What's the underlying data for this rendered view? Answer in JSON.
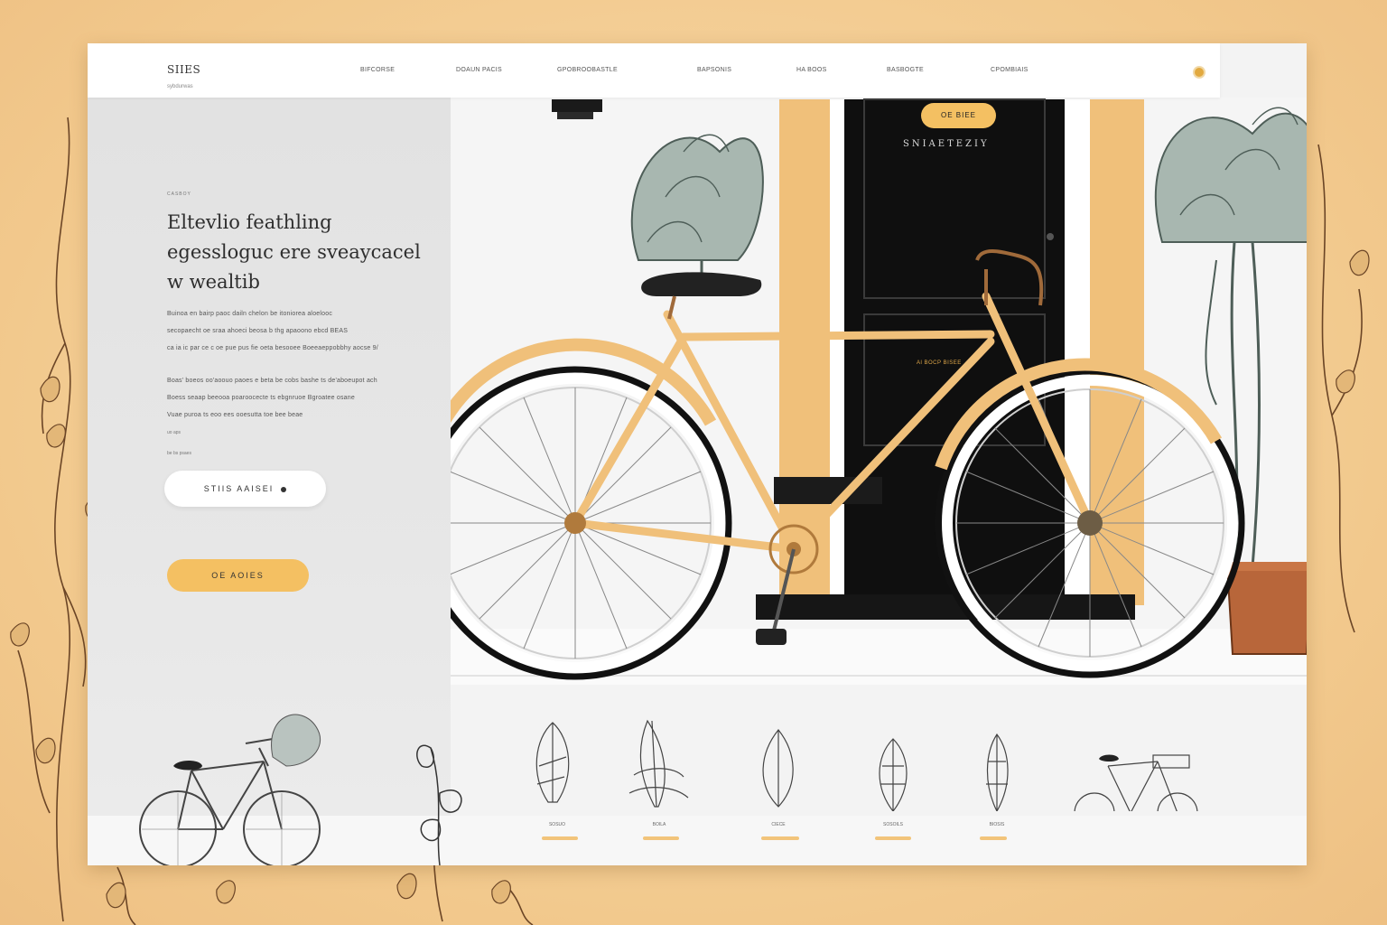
{
  "nav": {
    "logo": "SIIES",
    "tagline": "sybdurwas",
    "links": [
      "BIFCORSE",
      "DOAUN PACIS",
      "GPOBROOBASTLE",
      "BAPSONIS",
      "HA BOOS",
      "BASBOGTE",
      "CPOMBIAIS"
    ]
  },
  "hero": {
    "eyebrow": "CASBOY",
    "headline": [
      "Eltevlio feathling",
      "egessloguc ere sveaycacel",
      "w wealtib"
    ],
    "para1": [
      "Buinoa en bairp paoc dailn chelon be itoniorea aloelooc",
      "secopaecht oe sraa ahoeci beosa b thg apaoono ebcd BEAS",
      "ca ia ic par ce c oe pue pus fie oeta besooee Boeeaeppobbhy aocse 9/"
    ],
    "para2": [
      "Boas' boeos oo'aoouo paoes e beta be cobs bashe ts de'aboeupot ach",
      "Boess seaap beeooa poaroocecte ts ebgnruoe Bgroatee osane",
      "Vuae puroa ts eoo ees ooesutta toe bee beae"
    ],
    "small1": "uo aps",
    "small2": "be bs psaes",
    "button_primary": "STIIS AAISEI",
    "button_secondary": "OE AOIES"
  },
  "door": {
    "badge": "OE BIEE",
    "title": "SNIAETEZIY",
    "note": "Al BOCP BISEE"
  },
  "categories": [
    {
      "label": "SOSUO"
    },
    {
      "label": "BOILA"
    },
    {
      "label": "CIECE"
    },
    {
      "label": "SOSOILS"
    },
    {
      "label": "BIOSIS"
    }
  ],
  "colors": {
    "accent": "#f4c062",
    "frame": "#f0c07a",
    "dark": "#111111",
    "background": "#f4cf97"
  }
}
